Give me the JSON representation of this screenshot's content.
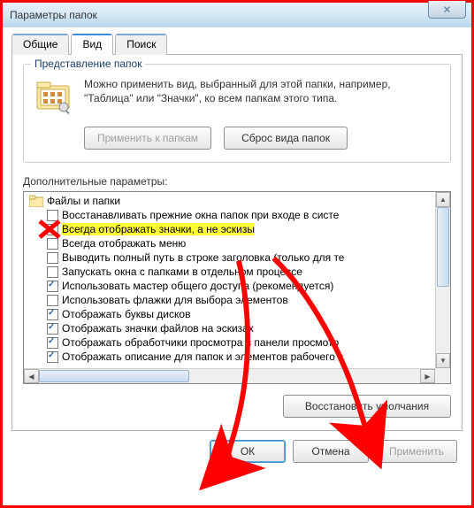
{
  "title": "Параметры папок",
  "tabs": {
    "t0": "Общие",
    "t1": "Вид",
    "t2": "Поиск"
  },
  "group": {
    "title": "Представление папок",
    "desc": "Можно применить вид, выбранный для этой папки, например, \"Таблица\" или \"Значки\", ко всем папкам этого типа.",
    "apply_btn": "Применить к папкам",
    "reset_btn": "Сброс вида папок"
  },
  "adv_label": "Дополнительные параметры:",
  "tree_root": "Файлы и папки",
  "items": [
    {
      "label": "Восстанавливать прежние окна папок при входе в систе",
      "checked": false
    },
    {
      "label": "Всегда отображать значки, а не эскизы",
      "checked": false,
      "highlight": true,
      "red_x": true
    },
    {
      "label": "Всегда отображать меню",
      "checked": false
    },
    {
      "label": "Выводить полный путь в строке заголовка (только для те",
      "checked": false
    },
    {
      "label": "Запускать окна с папками в отдельном процессе",
      "checked": false
    },
    {
      "label": "Использовать мастер общего доступа (рекомендуется)",
      "checked": true
    },
    {
      "label": "Использовать флажки для выбора элементов",
      "checked": false
    },
    {
      "label": "Отображать буквы дисков",
      "checked": true
    },
    {
      "label": "Отображать значки файлов на эскизах",
      "checked": true
    },
    {
      "label": "Отображать обработчики просмотра в панели просмотр",
      "checked": true
    },
    {
      "label": "Отображать описание для папок и элементов рабочего с",
      "checked": true
    }
  ],
  "restore_btn": "Восстановить умолчания",
  "buttons": {
    "ok": "ОК",
    "cancel": "Отмена",
    "apply": "Применить"
  }
}
